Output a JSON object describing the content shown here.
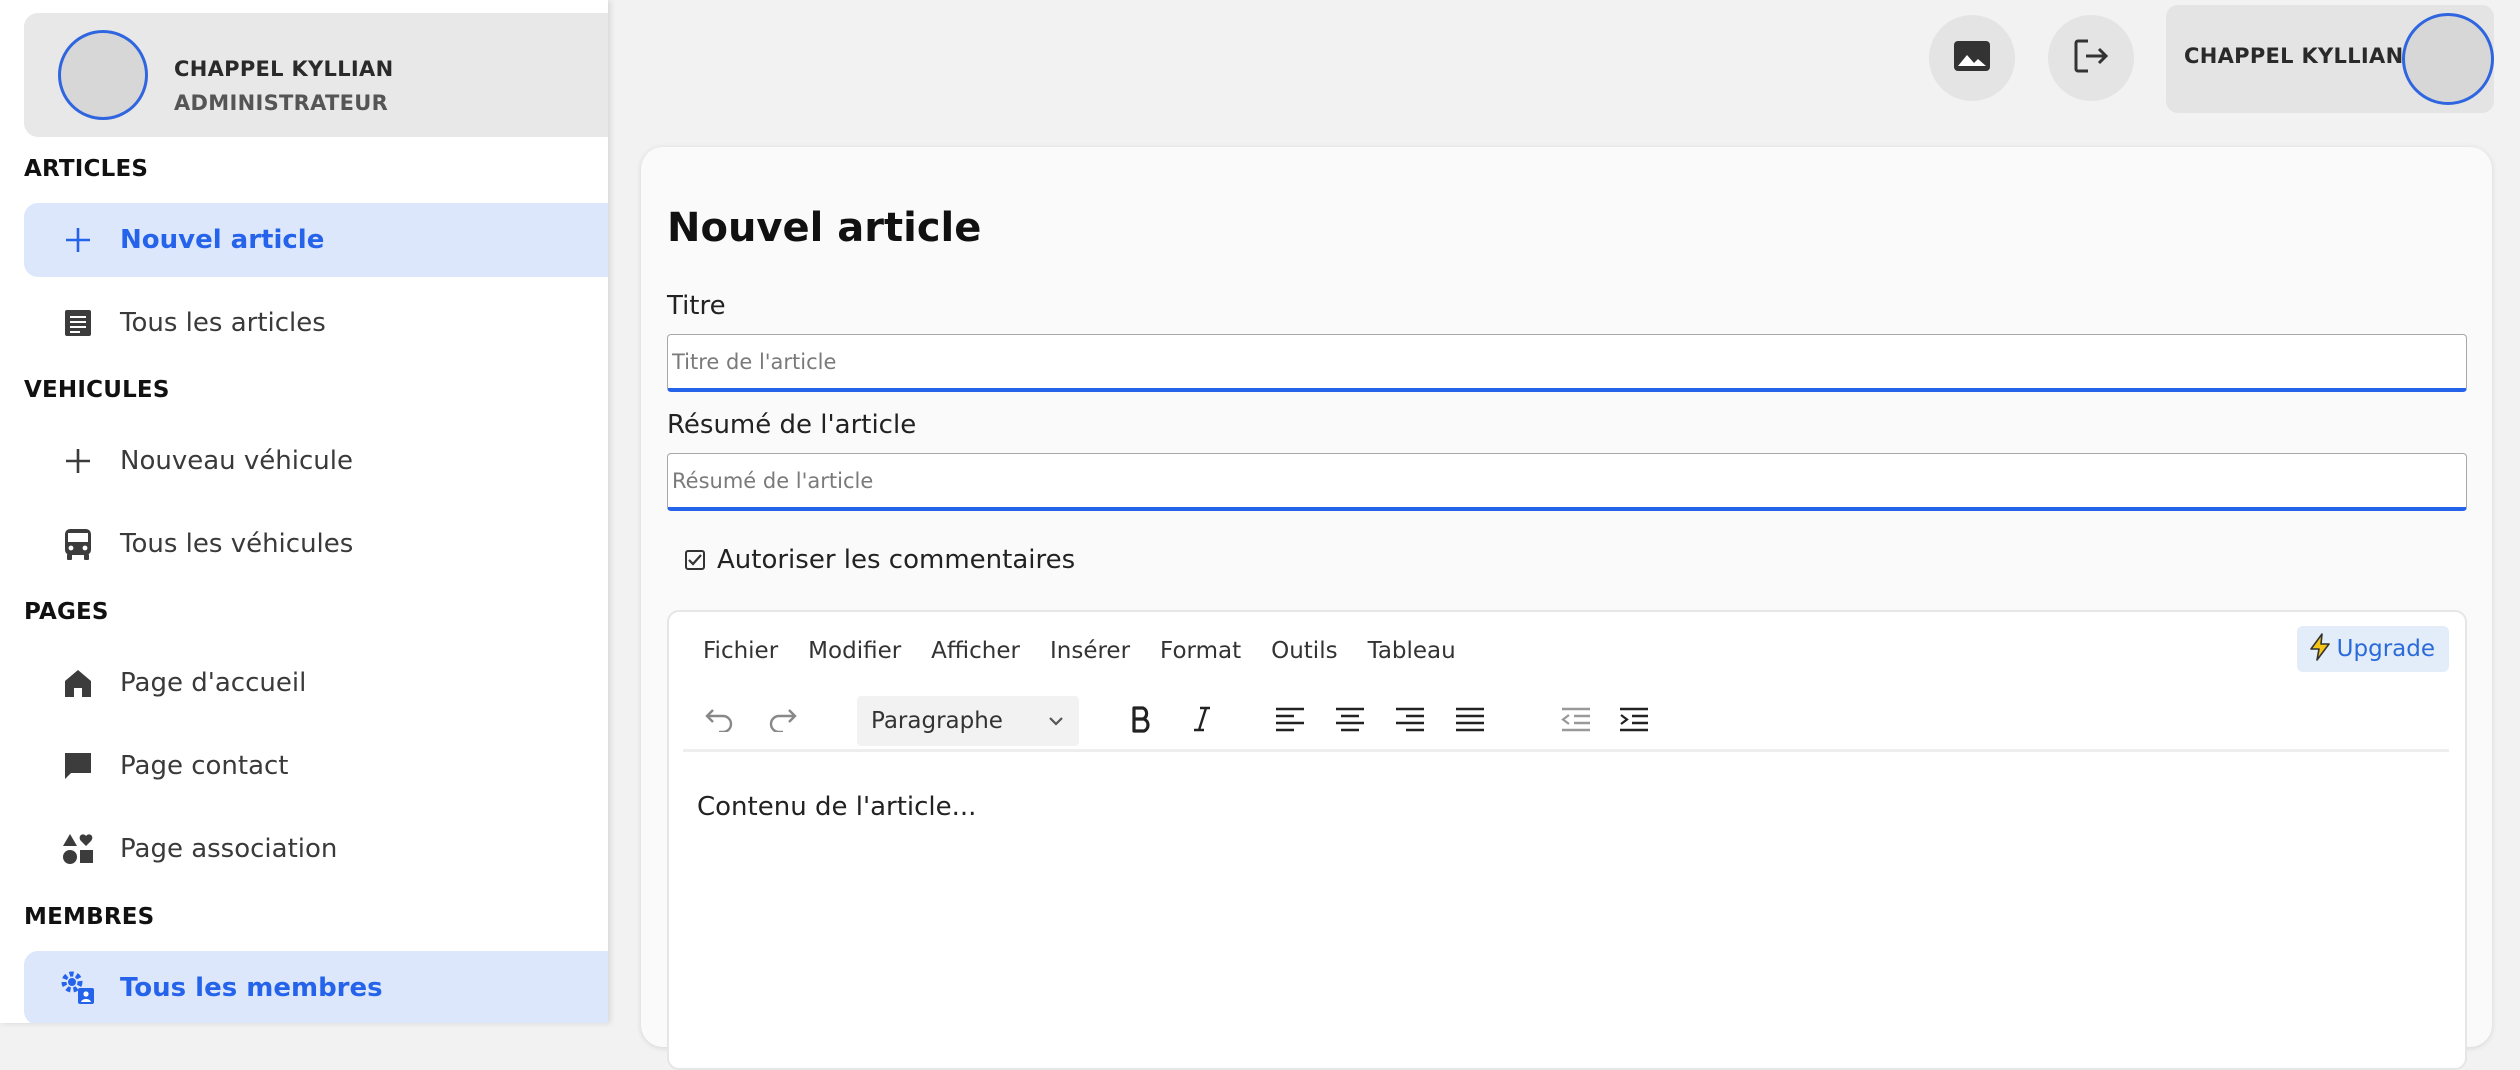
{
  "sidebar": {
    "profile": {
      "name": "CHAPPEL KYLLIAN",
      "role": "ADMINISTRATEUR"
    },
    "sections": {
      "articles": "ARTICLES",
      "vehicules": "VEHICULES",
      "pages": "PAGES",
      "membres": "MEMBRES"
    },
    "items": {
      "nouvel_article": "Nouvel article",
      "tous_articles": "Tous les articles",
      "nouveau_vehicule": "Nouveau véhicule",
      "tous_vehicules": "Tous les véhicules",
      "page_accueil": "Page d'accueil",
      "page_contact": "Page contact",
      "page_association": "Page association",
      "tous_membres": "Tous les membres"
    }
  },
  "topbar": {
    "user_name": "CHAPPEL KYLLIAN",
    "icons": [
      "image-icon",
      "logout-icon"
    ]
  },
  "form": {
    "title": "Nouvel article",
    "titre_label": "Titre",
    "titre_placeholder": "Titre de l'article",
    "titre_value": "",
    "resume_label": "Résumé de l'article",
    "resume_placeholder": "Résumé de l'article",
    "resume_value": "",
    "allow_comments_label": "Autoriser les commentaires",
    "allow_comments_checked": true
  },
  "editor": {
    "menu": [
      "Fichier",
      "Modifier",
      "Afficher",
      "Insérer",
      "Format",
      "Outils",
      "Tableau"
    ],
    "upgrade_label": "Upgrade",
    "block_format": "Paragraphe",
    "content": "Contenu de l'article..."
  },
  "colors": {
    "accent": "#2563eb",
    "active_bg": "#dce7fb",
    "upgrade_bg": "#e3ecf9"
  }
}
